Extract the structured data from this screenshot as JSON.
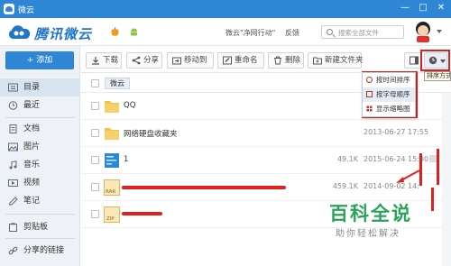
{
  "window": {
    "title": "微云",
    "minimize": "—",
    "maximize": "□",
    "close": "✕"
  },
  "header": {
    "logo_text": "腾讯微云",
    "platform_icons": [
      "apple-icon",
      "android-icon"
    ],
    "links": [
      "微云\"净网行动\"",
      "反馈"
    ],
    "search_placeholder": "搜索全部文件"
  },
  "sidebar": {
    "add_label": "+ 添加",
    "items": [
      {
        "label": "目录",
        "icon": "folder-icon",
        "active": true
      },
      {
        "label": "最近",
        "icon": "clock-icon"
      },
      {
        "label": "文档",
        "icon": "document-icon"
      },
      {
        "label": "图片",
        "icon": "image-icon"
      },
      {
        "label": "音乐",
        "icon": "music-icon"
      },
      {
        "label": "视频",
        "icon": "video-icon"
      },
      {
        "label": "笔记",
        "icon": "note-icon"
      },
      {
        "label": "剪贴板",
        "icon": "clipboard-icon"
      },
      {
        "label": "分享的链接",
        "icon": "link-icon"
      }
    ]
  },
  "toolbar": {
    "buttons": [
      {
        "label": "下载",
        "icon": "download-icon"
      },
      {
        "label": "分享",
        "icon": "share-icon"
      },
      {
        "label": "移动到",
        "icon": "move-icon"
      },
      {
        "label": "重命名",
        "icon": "rename-icon"
      },
      {
        "label": "删除",
        "icon": "delete-icon"
      },
      {
        "label": "新建文件夹",
        "icon": "new-folder-icon"
      }
    ]
  },
  "breadcrumb": {
    "current": "微云"
  },
  "files": [
    {
      "name": "QQ",
      "type": "folder",
      "size": "",
      "date": ""
    },
    {
      "name": "网络硬盘收藏夹",
      "type": "folder",
      "size": "",
      "date": "2013-06-27 17:55"
    },
    {
      "name": "1",
      "type": "image",
      "size": "49.1K",
      "date": "2015-06-24 15:00"
    },
    {
      "name": "",
      "type": "rar",
      "size": "459.1K",
      "date": "2014-09-02 14:"
    },
    {
      "name": "",
      "type": "zip",
      "size": "",
      "date": ""
    }
  ],
  "file_type_labels": {
    "rar": "RAR",
    "zip": "ZIP"
  },
  "sort_menu": {
    "tooltip": "排序方式",
    "items": [
      {
        "label": "按时间排序",
        "icon": "time-sort-icon"
      },
      {
        "label": "按字母顺序",
        "icon": "alpha-sort-icon",
        "selected": true
      },
      {
        "label": "显示缩略图",
        "icon": "thumbnail-icon"
      }
    ]
  },
  "watermark": {
    "title": "百科全说",
    "subtitle": "助你轻松解决"
  },
  "colors": {
    "brand": "#2f86d4",
    "annotation": "#e0201f",
    "watermark": "#29a35a"
  }
}
